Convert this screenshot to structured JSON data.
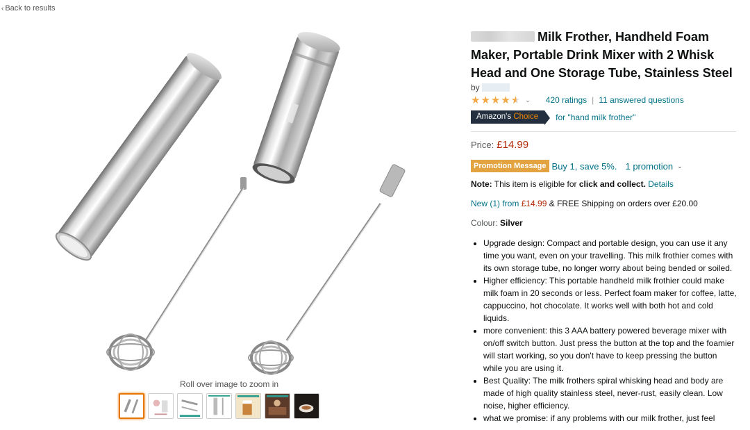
{
  "nav": {
    "back_label": "Back to results"
  },
  "gallery": {
    "zoom_hint": "Roll over image to zoom in",
    "thumbnails": [
      {
        "icon": "frother-pair-thumb",
        "selected": true
      },
      {
        "icon": "frother-usage-thumb",
        "selected": false
      },
      {
        "icon": "frother-parts-thumb",
        "selected": false
      },
      {
        "icon": "frother-size-thumb",
        "selected": false
      },
      {
        "icon": "drink-thumb",
        "selected": false
      },
      {
        "icon": "cafe-thumb",
        "selected": false
      },
      {
        "icon": "coffee-cup-thumb",
        "selected": false
      }
    ]
  },
  "product": {
    "title": "Milk Frother, Handheld Foam Maker, Portable Drink Mixer with 2 Whisk Head and One Storage Tube, Stainless Steel",
    "by_label": "by",
    "ratings_count": "420 ratings",
    "answered_questions": "11 answered questions",
    "star_rating": 4.5,
    "badge_prefix": "Amazon's",
    "badge_highlight": "Choice",
    "choice_for": "for \"hand milk frother\"",
    "price_label": "Price:",
    "price": "£14.99",
    "promo_tag": "Promotion Message",
    "promo_text": "Buy 1, save 5%.",
    "promo_count": "1 promotion",
    "note_label": "Note:",
    "note_text": "This item is eligible for",
    "note_bold": "click and collect.",
    "note_link": "Details",
    "offer_link": "New (1) from",
    "offer_price": "£14.99",
    "offer_rest": "& FREE Shipping on orders over £20.00",
    "colour_label": "Colour:",
    "colour_value": "Silver",
    "bullets": [
      "Upgrade design: Compact and portable design, you can use it any time you want, even on your travelling. This milk frothier comes with its own storage tube, no longer worry about being bended or soiled.",
      "Higher efficiency: This portable handheld milk frothier could make milk foam in 20 seconds or less. Perfect foam maker for coffee, latte, cappuccino, hot chocolate. It works well with both hot and cold liquids.",
      "more convenient: this 3 AAA battery powered beverage mixer with on/off switch button. Just press the button at the top and the foamier will start working, so you don't have to keep pressing the button while you are using it.",
      "Best Quality: The milk frothers spiral whisking head and body are made of high quality stainless steel, never-rust, easily clean. Low noise, higher efficiency.",
      "what we promise: if any problems with our milk frother, just feel"
    ]
  },
  "colors": {
    "link": "#007185",
    "price": "#b12704",
    "badge_bg": "#232f3e",
    "badge_accent": "#f08804",
    "promo": "#e3a340",
    "star": "#f3a847"
  }
}
